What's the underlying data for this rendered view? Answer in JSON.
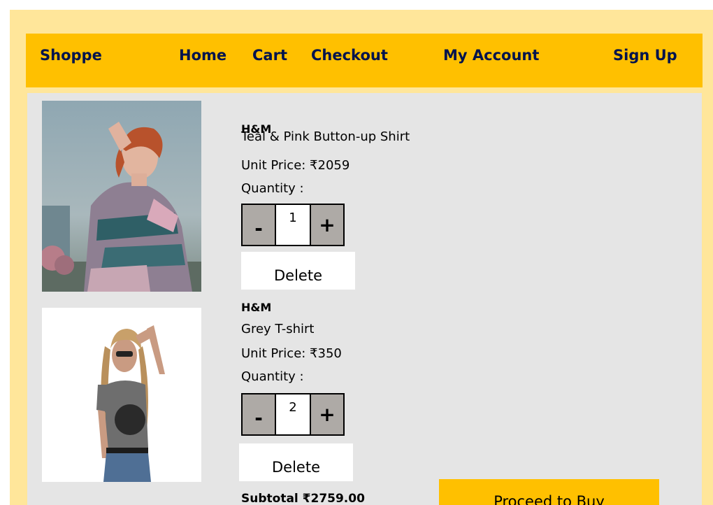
{
  "nav": {
    "brand": "Shoppe",
    "links": [
      "Home",
      "Cart",
      "Checkout",
      "My Account",
      "Sign Up"
    ]
  },
  "cart": {
    "items": [
      {
        "brand": "H&M",
        "name": "Teal & Pink Button-up Shirt",
        "unit_price": "Unit Price: ₹2059",
        "quantity_label": "Quantity :",
        "quantity": "1",
        "minus": "-",
        "plus": "+",
        "delete_label": "Delete"
      },
      {
        "brand": "H&M",
        "name": "Grey T-shirt",
        "unit_price": "Unit Price: ₹350",
        "quantity_label": "Quantity :",
        "quantity": "2",
        "minus": "-",
        "plus": "+",
        "delete_label": "Delete"
      }
    ],
    "subtotal": "Subtotal ₹2759.00",
    "buy_label": "Proceed to Buy"
  },
  "colors": {
    "page_bg": "#ffe69a",
    "nav_bg": "#ffc000",
    "content_bg": "#e5e5e5",
    "nav_text": "#00134d",
    "stepper_btn": "#aeaaa6"
  }
}
